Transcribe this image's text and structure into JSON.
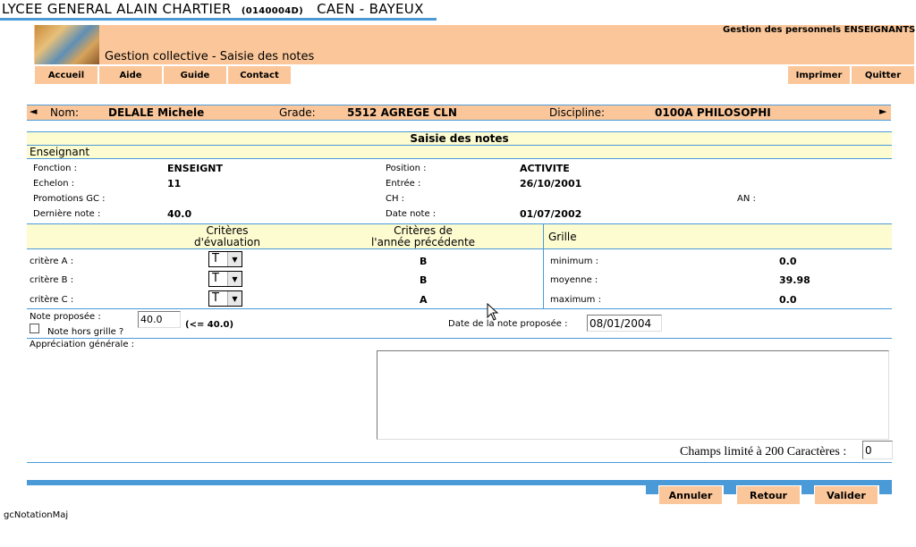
{
  "header": {
    "school_name": "LYCEE GENERAL ALAIN CHARTIER",
    "school_code": "(0140004D)",
    "school_city": "CAEN - BAYEUX",
    "app_title": "Gestion des personnels ENSEIGNANTS",
    "page_title": "Gestion collective - Saisie des notes"
  },
  "menu": {
    "accueil": "Accueil",
    "aide": "Aide",
    "guide": "Guide",
    "contact": "Contact",
    "imprimer": "Imprimer",
    "quitter": "Quitter"
  },
  "teacher": {
    "prev_arrow": "◄",
    "next_arrow": "►",
    "nom_label": "Nom:",
    "nom_value": "DELALE Michele",
    "grade_label": "Grade:",
    "grade_value": "5512 AGREGE CLN",
    "discipline_label": "Discipline:",
    "discipline_value": "0100A PHILOSOPHI"
  },
  "section": {
    "title": "Saisie des notes",
    "subtitle": "Enseignant"
  },
  "info": {
    "fonction_label": "Fonction :",
    "fonction_value": "ENSEIGNT",
    "echelon_label": "Echelon :",
    "echelon_value": "11",
    "promotions_label": "Promotions GC :",
    "derniere_note_label": "Dernière note :",
    "derniere_note_value": "40.0",
    "position_label": "Position :",
    "position_value": "ACTIVITE",
    "entree_label": "Entrée :",
    "entree_value": "26/10/2001",
    "ch_label": "CH :",
    "date_note_label": "Date note :",
    "date_note_value": "01/07/2002",
    "an_label": "AN :"
  },
  "criteria": {
    "header_eval_line1": "Critères",
    "header_eval_line2": "d'évaluation",
    "header_prev_line1": "Critères de",
    "header_prev_line2": "l'année précédente",
    "header_grille": "Grille",
    "rows": [
      {
        "label": "critère A :",
        "selected": "T",
        "previous": "B"
      },
      {
        "label": "critère B :",
        "selected": "T",
        "previous": "B"
      },
      {
        "label": "critère C :",
        "selected": "T",
        "previous": "A"
      }
    ],
    "grille": [
      {
        "label": "minimum :",
        "value": "0.0"
      },
      {
        "label": "moyenne :",
        "value": "39.98"
      },
      {
        "label": "maximum :",
        "value": "0.0"
      }
    ]
  },
  "proposal": {
    "note_label": "Note proposée :",
    "note_value": "40.0",
    "note_hint": "(<= 40.0)",
    "hors_grille_label": "Note hors grille ?",
    "date_label": "Date de la note proposée :",
    "date_value": "08/01/2004"
  },
  "appreciation": {
    "label": "Appréciation générale :",
    "text": "",
    "limit_label": "Champs limité à 200 Caractères :",
    "count": "0"
  },
  "actions": {
    "annuler": "Annuler",
    "retour": "Retour",
    "valider": "Valider"
  },
  "footer": {
    "page_code": "gcNotationMaj"
  },
  "colors": {
    "accent_blue": "#4a9ad8",
    "salmon": "#fbc79a",
    "pale_yellow": "#fdfbd0"
  }
}
